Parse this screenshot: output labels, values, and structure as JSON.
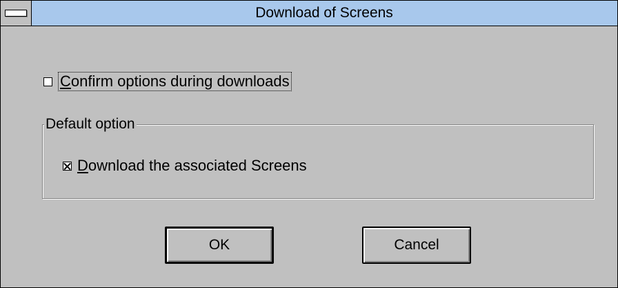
{
  "window": {
    "title": "Download of Screens"
  },
  "confirm_option": {
    "label_underlined": "C",
    "label_rest": "onfirm options during downloads",
    "checked": false
  },
  "default_option": {
    "group_title": "Default option",
    "download_checkbox": {
      "label_underlined": "D",
      "label_rest": "ownload the associated Screens",
      "checked": true
    }
  },
  "buttons": {
    "ok_label": "OK",
    "cancel_label": "Cancel"
  },
  "colors": {
    "titlebar": "#a8c8ec",
    "face": "#c0c0c0"
  }
}
